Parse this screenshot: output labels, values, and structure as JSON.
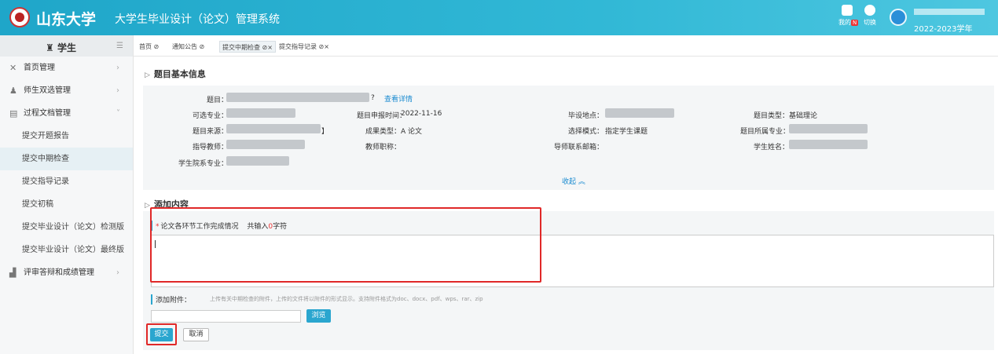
{
  "header": {
    "university": "山东大学",
    "system_name": "大学生毕业设计（论文）管理系统",
    "icons": [
      {
        "name": "inbox-icon",
        "label": "我的",
        "badge": "N"
      },
      {
        "name": "switch-icon",
        "label": "切换"
      }
    ],
    "academic_year": "2022-2023学年"
  },
  "sidebar": {
    "role": "学生",
    "items": [
      {
        "label": "首页管理",
        "icon": "tools-icon"
      },
      {
        "label": "师生双选管理",
        "icon": "users-icon"
      },
      {
        "label": "过程文档管理",
        "icon": "document-icon",
        "expanded": true,
        "children": [
          "提交开题报告",
          "提交中期检查",
          "提交指导记录",
          "提交初稿",
          "提交毕业设计（论文）检测版",
          "提交毕业设计（论文）最终版"
        ]
      },
      {
        "label": "评审答辩和成绩管理",
        "icon": "chart-icon"
      }
    ],
    "active_child": "提交中期检查"
  },
  "tabs": [
    {
      "label": "首页 ⊘"
    },
    {
      "label": "通知公告 ⊘"
    },
    {
      "label": "提交中期检查 ⊘×",
      "active": true
    },
    {
      "label": "提交指导记录 ⊘×"
    }
  ],
  "topic_info": {
    "section_title": "题目基本信息",
    "labels": {
      "topic": "题目：",
      "major": "可选专业：",
      "source": "题目来源：",
      "teacher": "指导教师：",
      "student_major": "学生院系专业：",
      "declare_time": "题目申报时间：",
      "result_type": "成果类型：",
      "teacher_title": "教师职称：",
      "location": "毕设地点：",
      "select_mode": "选择模式：",
      "teacher_email": "导师联系邮箱：",
      "topic_type": "题目类型：",
      "topic_major": "题目所属专业：",
      "student_name": "学生姓名："
    },
    "values": {
      "topic_suffix": "?",
      "declare_time": "2022-11-16",
      "result_type": "A 论文",
      "select_mode": "指定学生课题",
      "topic_type": "基础理论",
      "source_suffix": "】"
    },
    "view_detail_link": "查看详情",
    "collapse_link": "收起 ︽"
  },
  "add_content": {
    "section_title": "添加内容",
    "field_required_mark": "*",
    "field_label": "论文各环节工作完成情况",
    "count_prefix": "共输入",
    "count_value": "0",
    "count_suffix": "字符",
    "textarea_value": "",
    "attach_label": "添加附件：",
    "attach_hint": "上传有关中期检查的附件，上传的文件将以附件的形式显示。支持附件格式为doc、docx、pdf、wps、rar、zip",
    "browse_label": "浏览",
    "submit_label": "提交",
    "cancel_label": "取消"
  },
  "colors": {
    "header": "#1fa6c9",
    "accent": "#2aa6cf",
    "highlight_box": "#e02828"
  }
}
